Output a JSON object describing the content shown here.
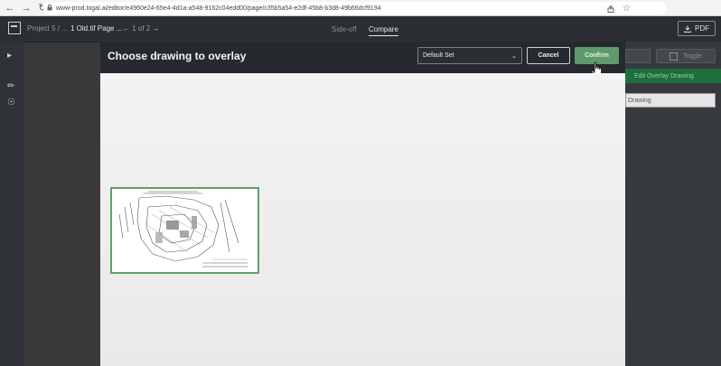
{
  "browser": {
    "url": "www-prod.togal.ai/editor/e4960e24-65e4-4d1a-a548-9162c04edd00/page/c35b5a54-e2df-45b8-b3d8-49b66dcf9194"
  },
  "app": {
    "breadcrumb": {
      "project": "Project 5 / ...",
      "page": "1 Old.tif Page ...",
      "page_nav": "1 of 2"
    },
    "tabs": [
      {
        "label": "Side-off",
        "active": false
      },
      {
        "label": "Compare",
        "active": true
      }
    ],
    "export_label": "PDF"
  },
  "right_panel": {
    "button1": "",
    "button2": "Toggle",
    "action": "Edit Overlay Drawing",
    "field_value": "Drawing"
  },
  "modal": {
    "title": "Choose drawing to overlay",
    "set_select": "Default Set",
    "cancel_label": "Cancel",
    "confirm_label": "Confirm"
  },
  "icons": {
    "back": "arrow-left-icon",
    "forward": "arrow-right-icon",
    "reload": "reload-icon",
    "share": "share-icon",
    "star": "star-icon",
    "download": "download-icon",
    "cursor": "hand-pointer-icon"
  },
  "colors": {
    "accent_green": "#5e9a6a",
    "modal_header": "#262a2f",
    "thumb_border": "#5ea16f"
  }
}
